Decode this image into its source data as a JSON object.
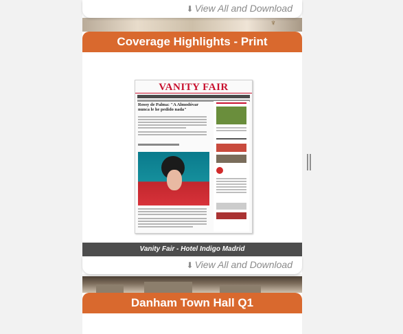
{
  "top_card": {
    "download_label": "View All and Download",
    "download_icon": "download-icon"
  },
  "print_section": {
    "title": "Coverage Highlights - Print",
    "clipping": {
      "masthead": "VANITY FAIR",
      "headline": "Rossy de Palma: \"A Almodóvar nunca le he pedido nada\""
    },
    "caption": "Vanity Fair - Hotel Indigo Madrid",
    "download_label": "View All and Download",
    "download_icon": "download-icon"
  },
  "next_section": {
    "title": "Danham Town Hall Q1"
  },
  "colors": {
    "header_orange": "#d9692e",
    "caption_gray": "#4d4d4d",
    "link_gray": "#8a8a8a"
  }
}
